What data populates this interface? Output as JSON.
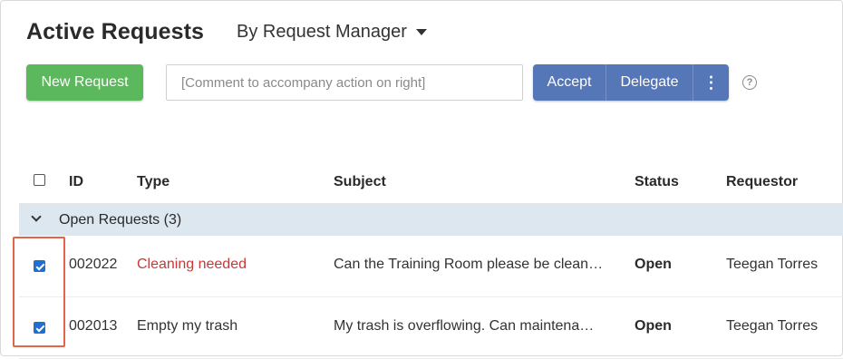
{
  "header": {
    "title": "Active Requests",
    "view_selector": "By Request Manager"
  },
  "toolbar": {
    "new_request_label": "New Request",
    "comment_placeholder": "[Comment to accompany action on right]",
    "comment_value": "",
    "accept_label": "Accept",
    "delegate_label": "Delegate",
    "more_label": "⋮",
    "help_label": "?"
  },
  "table": {
    "columns": {
      "id": "ID",
      "type": "Type",
      "subject": "Subject",
      "status": "Status",
      "requestor": "Requestor"
    },
    "select_all_checked": false,
    "group": {
      "label": "Open Requests (3)",
      "expanded": true
    },
    "rows": [
      {
        "checked": true,
        "id": "002022",
        "type": "Cleaning needed",
        "type_color": "#c43a3a",
        "subject": "Can the Training Room please be clean…",
        "status": "Open",
        "requestor": "Teegan Torres"
      },
      {
        "checked": true,
        "id": "002013",
        "type": "Empty my trash",
        "type_color": "#333333",
        "subject": "My trash is overflowing. Can maintena…",
        "status": "Open",
        "requestor": "Teegan Torres"
      }
    ]
  },
  "colors": {
    "new_request_bg": "#5cb85c",
    "action_bg": "#5577b7",
    "group_row_bg": "#dde7f0",
    "checkbox_checked": "#1f6fd1",
    "highlight_border": "#e0654a"
  },
  "icons": {
    "view_caret": "caret-down-icon",
    "more": "vertical-ellipsis-icon",
    "help": "question-circle-icon",
    "group_toggle": "chevron-down-icon"
  }
}
